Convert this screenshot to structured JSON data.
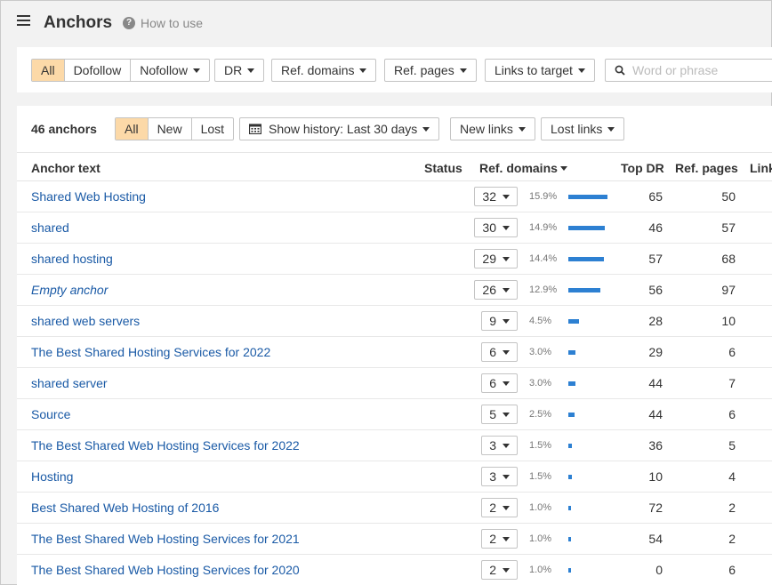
{
  "header": {
    "title": "Anchors",
    "help_glyph": "?",
    "help_label": "How to use"
  },
  "filters": {
    "link_type": [
      "All",
      "Dofollow",
      "Nofollow"
    ],
    "link_type_active": "All",
    "dr_label": "DR",
    "ref_domains_label": "Ref. domains",
    "ref_pages_label": "Ref. pages",
    "links_to_target_label": "Links to target",
    "search_placeholder": "Word or phrase",
    "search_value": ""
  },
  "toolbar": {
    "count_label": "46 anchors",
    "tabs": [
      "All",
      "New",
      "Lost"
    ],
    "tab_active": "All",
    "history_label": "Show history: Last 30 days",
    "new_links_label": "New links",
    "lost_links_label": "Lost links"
  },
  "table": {
    "columns": {
      "anchor_text": "Anchor text",
      "status": "Status",
      "ref_domains": "Ref. domains",
      "top_dr": "Top DR",
      "ref_pages": "Ref. pages",
      "links": "Link"
    },
    "rows": [
      {
        "anchor": "Shared Web Hosting",
        "empty": false,
        "ref_domains": "32",
        "pct": "15.9%",
        "share": 0.159,
        "top_dr": "65",
        "ref_pages": "50"
      },
      {
        "anchor": "shared",
        "empty": false,
        "ref_domains": "30",
        "pct": "14.9%",
        "share": 0.149,
        "top_dr": "46",
        "ref_pages": "57"
      },
      {
        "anchor": "shared hosting",
        "empty": false,
        "ref_domains": "29",
        "pct": "14.4%",
        "share": 0.144,
        "top_dr": "57",
        "ref_pages": "68"
      },
      {
        "anchor": "Empty anchor",
        "empty": true,
        "ref_domains": "26",
        "pct": "12.9%",
        "share": 0.129,
        "top_dr": "56",
        "ref_pages": "97"
      },
      {
        "anchor": "shared web servers",
        "empty": false,
        "ref_domains": "9",
        "pct": "4.5%",
        "share": 0.045,
        "top_dr": "28",
        "ref_pages": "10"
      },
      {
        "anchor": "The Best Shared Hosting Services for 2022",
        "empty": false,
        "ref_domains": "6",
        "pct": "3.0%",
        "share": 0.03,
        "top_dr": "29",
        "ref_pages": "6"
      },
      {
        "anchor": "shared server",
        "empty": false,
        "ref_domains": "6",
        "pct": "3.0%",
        "share": 0.03,
        "top_dr": "44",
        "ref_pages": "7"
      },
      {
        "anchor": "Source",
        "empty": false,
        "ref_domains": "5",
        "pct": "2.5%",
        "share": 0.025,
        "top_dr": "44",
        "ref_pages": "6"
      },
      {
        "anchor": "The Best Shared Web Hosting Services for 2022",
        "empty": false,
        "ref_domains": "3",
        "pct": "1.5%",
        "share": 0.015,
        "top_dr": "36",
        "ref_pages": "5"
      },
      {
        "anchor": "Hosting",
        "empty": false,
        "ref_domains": "3",
        "pct": "1.5%",
        "share": 0.015,
        "top_dr": "10",
        "ref_pages": "4"
      },
      {
        "anchor": "Best Shared Web Hosting of 2016",
        "empty": false,
        "ref_domains": "2",
        "pct": "1.0%",
        "share": 0.01,
        "top_dr": "72",
        "ref_pages": "2"
      },
      {
        "anchor": "The Best Shared Web Hosting Services for 2021",
        "empty": false,
        "ref_domains": "2",
        "pct": "1.0%",
        "share": 0.01,
        "top_dr": "54",
        "ref_pages": "2"
      },
      {
        "anchor": "The Best Shared Web Hosting Services for 2020",
        "empty": false,
        "ref_domains": "2",
        "pct": "1.0%",
        "share": 0.01,
        "top_dr": "0",
        "ref_pages": "6"
      }
    ]
  },
  "colors": {
    "link": "#1a5aa6",
    "bar": "#2d80d2",
    "active_tab": "#fcd9a8"
  },
  "icons": {
    "menu": "hamburger-icon",
    "help": "help-circle-icon",
    "search": "search-icon",
    "calendar": "calendar-icon"
  }
}
